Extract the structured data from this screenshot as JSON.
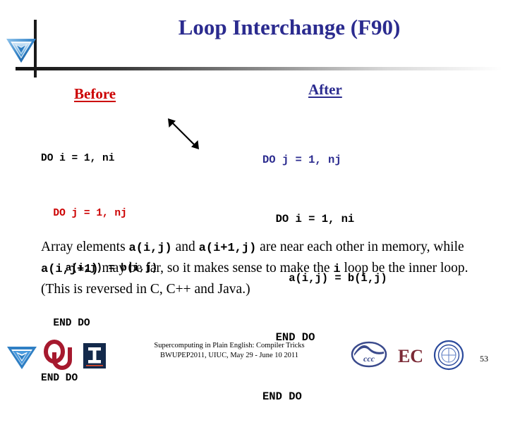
{
  "header": {
    "title": "Loop Interchange (F90)",
    "logo_icon": "blue-pyramid-logo-icon",
    "title_color": "#2b2b8f"
  },
  "columns": {
    "before": {
      "heading": "Before",
      "heading_color": "#cc0000",
      "code_lines": [
        {
          "text": "DO i = 1, ni",
          "color": "black"
        },
        {
          "text": "  DO j = 1, nj",
          "color": "red"
        },
        {
          "text": "    a(i,j) = b(i,j)",
          "color": "black"
        },
        {
          "text": "  END DO",
          "color": "black"
        },
        {
          "text": "END DO",
          "color": "black"
        }
      ]
    },
    "after": {
      "heading": "After",
      "heading_color": "#2b2b8f",
      "code_lines": [
        {
          "text": "DO j = 1, nj",
          "color": "navy"
        },
        {
          "text": "  DO i = 1, ni",
          "color": "black"
        },
        {
          "text": "    a(i,j) = b(i,j)",
          "color": "black"
        },
        {
          "text": "  END DO",
          "color": "black"
        },
        {
          "text": "END DO",
          "color": "black"
        }
      ]
    }
  },
  "annotation": {
    "arrow_icon": "double-headed-arrow-icon",
    "arrow_color": "#000000"
  },
  "body": {
    "segments": [
      {
        "text": "Array elements  ",
        "mono": false
      },
      {
        "text": "a(i,j)",
        "mono": true
      },
      {
        "text": " and  ",
        "mono": false
      },
      {
        "text": "a(i+1,j)",
        "mono": true
      },
      {
        "text": " are near each other in memory, while ",
        "mono": false
      },
      {
        "text": "a(i,j+1)",
        "mono": true
      },
      {
        "text": "  may be far, so it makes sense to make the  ",
        "mono": false
      },
      {
        "text": "i",
        "mono": true
      },
      {
        "text": "  loop be the inner loop. (This is reversed in C, C++ and Java.)",
        "mono": false
      }
    ]
  },
  "footer": {
    "line1": "Supercomputing in Plain English: Compiler Tricks",
    "line2": "BWUPEP2011, UIUC, May 29 - June 10 2011",
    "page_number": "53",
    "logos_left": [
      "blue-pyramid-logo-icon",
      "ou-logo-icon",
      "illinois-logo-icon"
    ],
    "logos_right": [
      "ccc-logo-icon",
      "ec-logo-icon",
      "university-seal-icon"
    ]
  }
}
